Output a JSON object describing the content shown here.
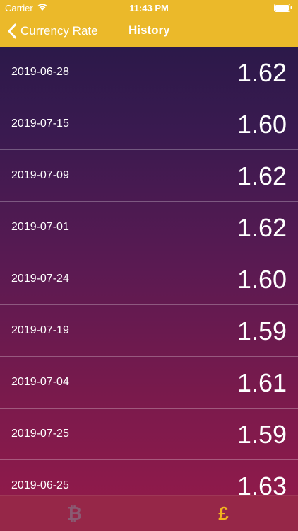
{
  "status_bar": {
    "carrier": "Carrier",
    "time": "11:43 PM"
  },
  "nav": {
    "back_label": "Currency Rate",
    "title": "History"
  },
  "history": [
    {
      "date": "2019-06-28",
      "rate": "1.62"
    },
    {
      "date": "2019-07-15",
      "rate": "1.60"
    },
    {
      "date": "2019-07-09",
      "rate": "1.62"
    },
    {
      "date": "2019-07-01",
      "rate": "1.62"
    },
    {
      "date": "2019-07-24",
      "rate": "1.60"
    },
    {
      "date": "2019-07-19",
      "rate": "1.59"
    },
    {
      "date": "2019-07-04",
      "rate": "1.61"
    },
    {
      "date": "2019-07-25",
      "rate": "1.59"
    },
    {
      "date": "2019-06-25",
      "rate": "1.63"
    }
  ],
  "tabs": [
    {
      "icon": "bitcoin-icon",
      "glyph": "₿",
      "selected": false
    },
    {
      "icon": "pound-icon",
      "glyph": "£",
      "selected": true
    }
  ],
  "colors": {
    "nav_bar": "#ebb92a",
    "tab_selected": "#f2b51e",
    "tab_unselected": "#8a5a72"
  }
}
